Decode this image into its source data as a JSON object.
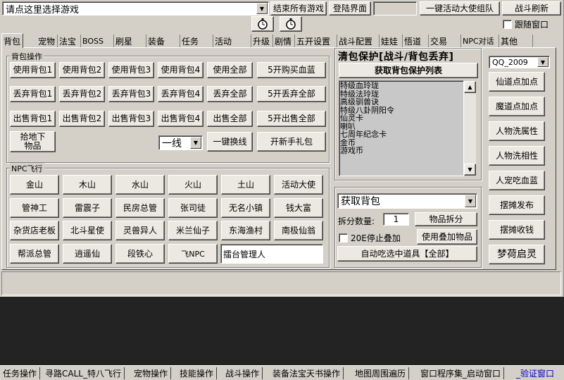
{
  "top": {
    "game_select": "请点这里选择游戏",
    "end_all_games": "结束所有游戏",
    "login_ui": "登陆界面",
    "one_key_team": "一键活动大使组队",
    "battle_refresh": "战斗刷新",
    "follow_window": "跟随窗口"
  },
  "tabs": [
    "背包",
    "宠物",
    "法宝",
    "BOSS",
    "刷星",
    "装备",
    "任务",
    "活动",
    "升级",
    "剧情",
    "五开设置",
    "战斗配置",
    "娃娃",
    "悟道",
    "交易",
    "NPC对话",
    "其他"
  ],
  "bag": {
    "group_label": "背包操作",
    "use": [
      "使用背包1",
      "使用背包2",
      "使用背包3",
      "使用背包4",
      "使用全部",
      "5开购买血蓝"
    ],
    "discard": [
      "丢弃背包1",
      "丢弃背包2",
      "丢弃背包3",
      "丢弃背包4",
      "丢弃全部",
      "5开丢弃全部"
    ],
    "sell": [
      "出售背包1",
      "出售背包2",
      "出售背包3",
      "出售背包4",
      "出售全部",
      "5开出售全部"
    ],
    "pickup": "拾地下物品",
    "line_value": "一线",
    "switch_line": "一键换线",
    "newbie_gift": "开新手礼包"
  },
  "npc": {
    "group_label": "NPC飞行",
    "rows": [
      [
        "金山",
        "木山",
        "水山",
        "火山",
        "土山",
        "活动大使"
      ],
      [
        "管神工",
        "雷震子",
        "民房总管",
        "张司徒",
        "无名小镇",
        "钱大富"
      ],
      [
        "杂货店老板",
        "北斗星使",
        "灵兽异人",
        "米兰仙子",
        "东海渔村",
        "南极仙翁"
      ],
      [
        "帮派总管",
        "逍遥仙",
        "段铁心",
        "飞NPC"
      ]
    ],
    "target_input": "擂台管理人"
  },
  "protect": {
    "title": "清包保护[战斗/背包丢弃]",
    "get_list": "获取背包保护列表",
    "items": [
      "特级血玲珑",
      "特级法玲珑",
      "高级驯兽诀",
      "特级八卦阴阳令",
      "仙灵卡",
      "喇叭",
      "七周年纪念卡",
      "金币",
      "游戏币"
    ]
  },
  "getbag": {
    "combo": "获取背包",
    "split_label": "拆分数量:",
    "split_value": "1",
    "split_button": "物品拆分",
    "stop_stack_label": "20E停止叠加",
    "use_stack": "使用叠加物品",
    "auto_eat": "自动吃选中道具【全部】"
  },
  "right": {
    "account": "QQ_2009",
    "buttons": [
      "仙道点加点",
      "魔道点加点",
      "人物洗属性",
      "人物洗相性",
      "人宠吃血蓝",
      "摆摊发布",
      "摆摊收钱"
    ],
    "brand": "梦荷启灵"
  },
  "bottom_tabs": [
    "任务操作",
    "寻路CALL_特八飞行",
    "宠物操作",
    "技能操作",
    "战斗操作",
    "装备法宝天书操作",
    "地图周围遍历",
    "窗口程序集_启动窗口",
    "_验证窗口"
  ]
}
